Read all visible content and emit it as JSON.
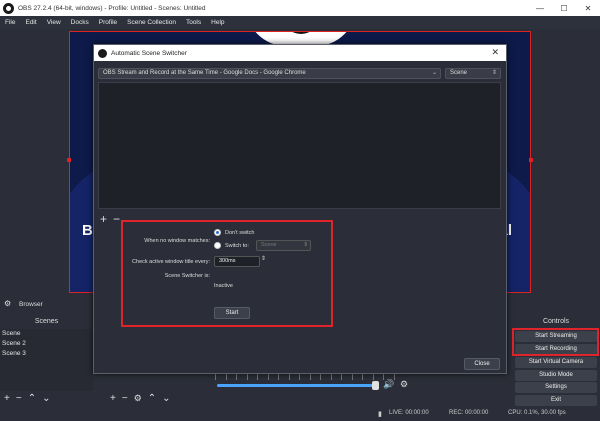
{
  "window": {
    "title": "OBS 27.2.4 (64-bit, windows) - Profile: Untitled - Scenes: Untitled",
    "minimize": "—",
    "maximize": "☐",
    "close": "✕"
  },
  "menu": [
    "File",
    "Edit",
    "View",
    "Docks",
    "Profile",
    "Scene Collection",
    "Tools",
    "Help"
  ],
  "preview": {
    "left_text": "B",
    "right_text": "al"
  },
  "docks": {
    "browser_label": "Browser",
    "scenes_title": "Scenes",
    "scenes": [
      "Scene",
      "Scene 2",
      "Scene 3"
    ],
    "controls_title": "Controls",
    "controls": [
      "Start Streaming",
      "Start Recording",
      "Start Virtual Camera",
      "Studio Mode",
      "Settings",
      "Exit"
    ]
  },
  "status": {
    "live": "LIVE: 00:00:00",
    "rec": "REC: 00:00:00",
    "cpu": "CPU: 0.1%, 30.00 fps"
  },
  "dialog": {
    "title": "Automatic Scene Switcher",
    "window_select": "OBS Stream and Record at the Same Time - Google Docs - Google Chrome",
    "scene_select": "Scene",
    "no_match_label": "When no window matches:",
    "dont_switch": "Don't switch",
    "switch_to": "Switch to:",
    "switch_to_scene": "Scene",
    "check_label": "Check active window title every:",
    "interval": "300ms",
    "status_label": "Scene Switcher is:",
    "status_value": "Inactive",
    "start_button": "Start",
    "close_button": "Close"
  },
  "colors": {
    "highlight": "#e0242c",
    "accent": "#4aa3ff"
  }
}
